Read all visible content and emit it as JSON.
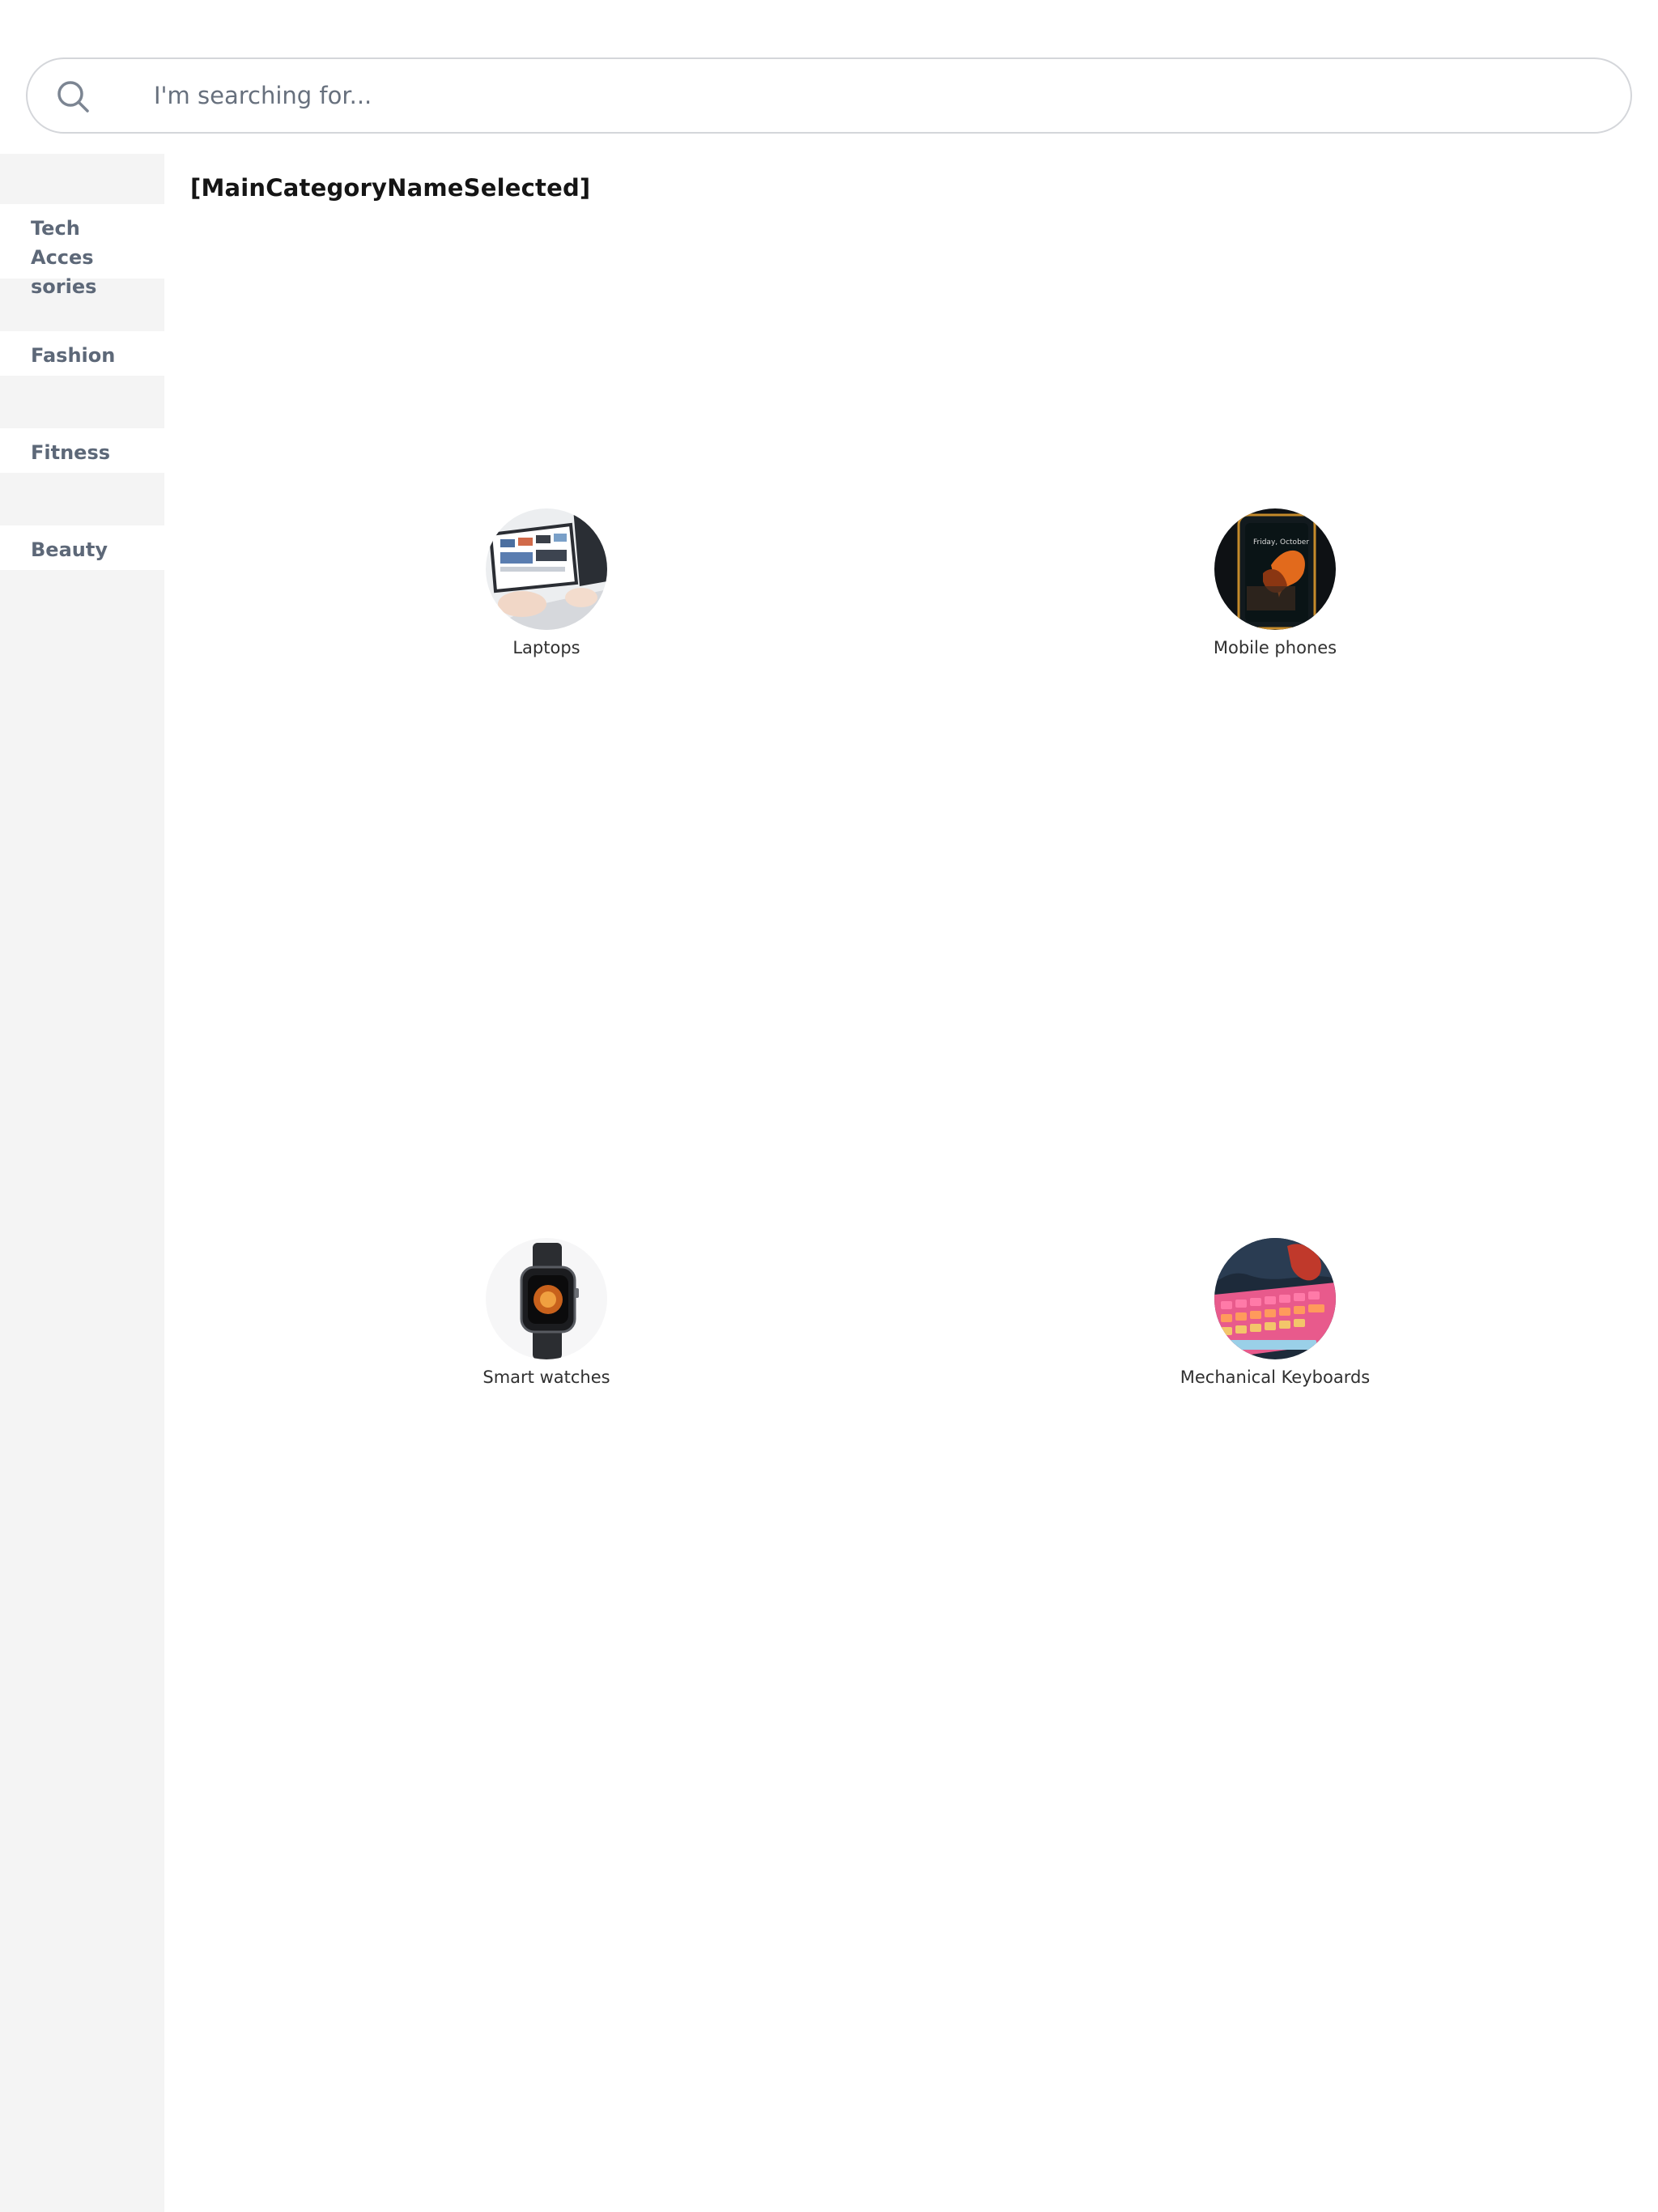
{
  "search": {
    "placeholder": "I'm searching for..."
  },
  "sidebar": {
    "items": [
      {
        "label": "Tech Acces sories"
      },
      {
        "label": "Fashion"
      },
      {
        "label": "Fitness"
      },
      {
        "label": "Beauty"
      }
    ]
  },
  "main": {
    "title": "[MainCategoryNameSelected]",
    "categories": [
      {
        "label": "Laptops"
      },
      {
        "label": "Mobile phones"
      },
      {
        "label": "Smart watches"
      },
      {
        "label": "Mechanical Keyboards"
      }
    ]
  },
  "colors": {
    "sidebar_bg": "#f4f4f4",
    "sidebar_text": "#5d6878",
    "search_border": "#d4d6da",
    "title_text": "#151515"
  }
}
